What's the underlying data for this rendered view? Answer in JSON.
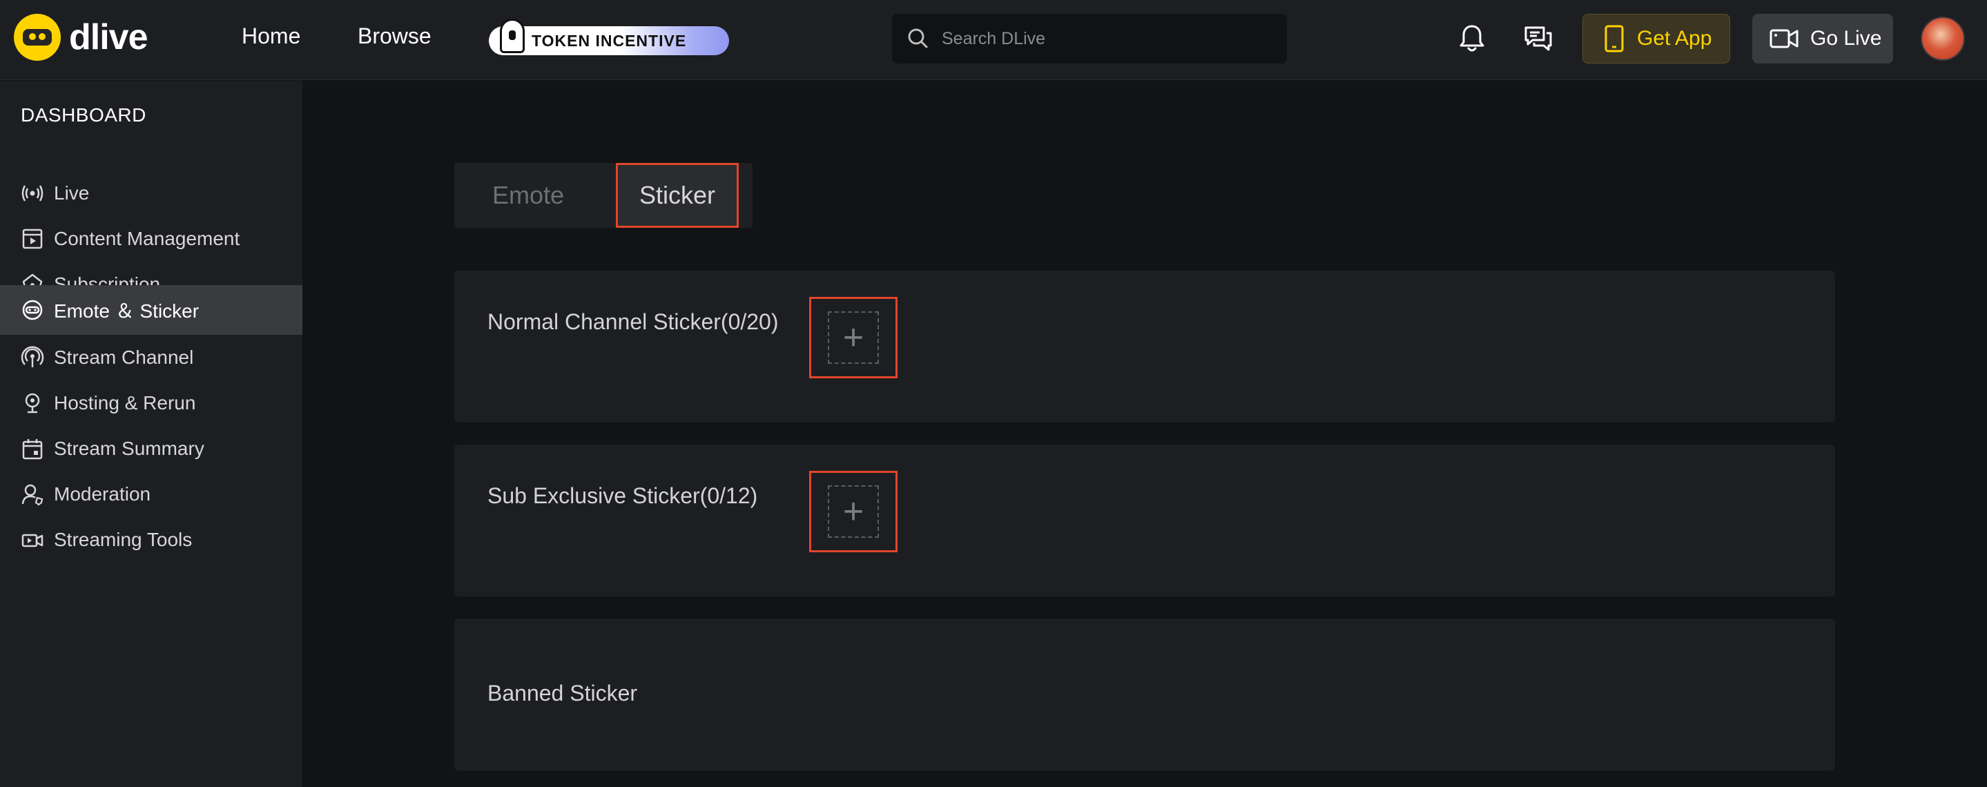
{
  "header": {
    "brand": "dlive",
    "nav": [
      {
        "label": "Home"
      },
      {
        "label": "Browse"
      }
    ],
    "promo_label": "TOKEN INCENTIVE",
    "search_placeholder": "Search DLive",
    "get_app_label": "Get App",
    "go_live_label": "Go Live",
    "icons": [
      "bell-icon",
      "chat-icon",
      "phone-icon",
      "camera-icon"
    ],
    "accent_color": "#ffd300"
  },
  "sidebar": {
    "title": "DASHBOARD",
    "items": [
      {
        "label": "Live",
        "icon": "broadcast-icon",
        "active": false
      },
      {
        "label": "Content Management",
        "icon": "video-file-icon",
        "active": false
      },
      {
        "label": "Subscription",
        "icon": "star-badge-icon",
        "active": false
      },
      {
        "label": "Emote ＆ Sticker",
        "icon": "emote-icon",
        "active": true
      },
      {
        "label": "Stream Channel",
        "icon": "signal-icon",
        "active": false
      },
      {
        "label": "Hosting & Rerun",
        "icon": "location-pin-icon",
        "active": false
      },
      {
        "label": "Stream Summary",
        "icon": "calendar-icon",
        "active": false
      },
      {
        "label": "Moderation",
        "icon": "user-shield-icon",
        "active": false
      },
      {
        "label": "Streaming Tools",
        "icon": "video-camera-icon",
        "active": false
      }
    ]
  },
  "main": {
    "tabs": [
      {
        "label": "Emote",
        "selected": false
      },
      {
        "label": "Sticker",
        "selected": true
      }
    ],
    "panels": [
      {
        "title": "Normal Channel Sticker(0/20)",
        "has_add": true
      },
      {
        "title": "Sub Exclusive Sticker(0/12)",
        "has_add": true
      },
      {
        "title": "Banned Sticker",
        "has_add": false
      }
    ],
    "add_glyph": "+",
    "highlight_color": "#e2462b"
  }
}
